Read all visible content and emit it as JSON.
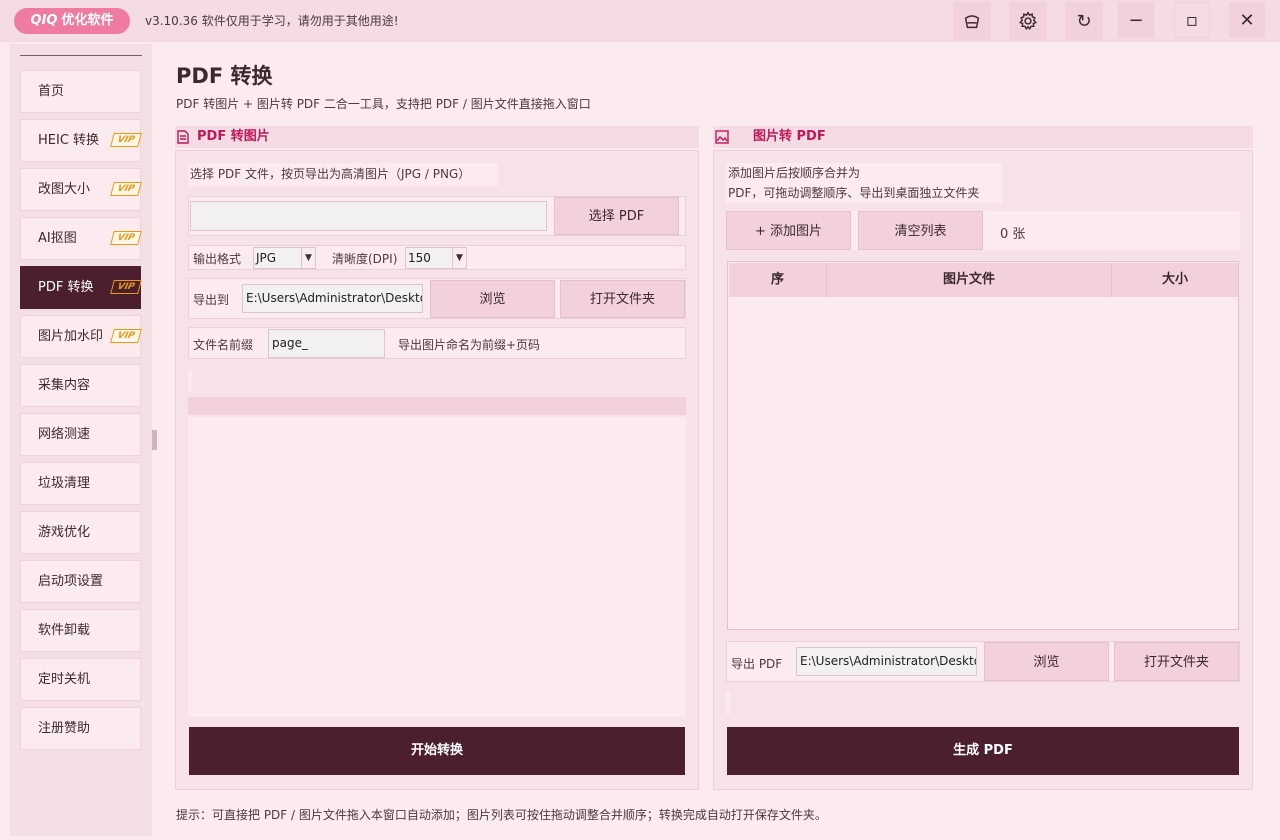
{
  "app": {
    "logo_brand": "QIQ",
    "logo_name": "优化软件",
    "version_text": "v3.10.36  软件仅用于学习，请勿用于其他用途!",
    "restore_glyph": "↻",
    "minimize_glyph": "−",
    "maximize_glyph": "▫",
    "close_glyph": "✕"
  },
  "sidebar": {
    "items": [
      {
        "label": "首页",
        "vip": false
      },
      {
        "label": "HEIC 转换",
        "vip": true
      },
      {
        "label": "改图大小",
        "vip": true
      },
      {
        "label": "AI抠图",
        "vip": true
      },
      {
        "label": "PDF 转换",
        "vip": true,
        "active": true
      },
      {
        "label": "图片加水印",
        "vip": true
      },
      {
        "label": "采集内容",
        "vip": false
      },
      {
        "label": "网络测速",
        "vip": false
      },
      {
        "label": "垃圾清理",
        "vip": false
      },
      {
        "label": "游戏优化",
        "vip": false
      },
      {
        "label": "启动项设置",
        "vip": false
      },
      {
        "label": "软件卸载",
        "vip": false
      },
      {
        "label": "定时关机",
        "vip": false
      },
      {
        "label": "注册赞助",
        "vip": false
      }
    ],
    "vip_label": "VIP"
  },
  "page": {
    "title": "PDF 转换",
    "subtitle": "PDF 转图片 + 图片转 PDF 二合一工具，支持把 PDF / 图片文件直接拖入窗口",
    "footer_tip": "提示：可直接把 PDF / 图片文件拖入本窗口自动添加；图片列表可按住拖动调整合并顺序；转换完成自动打开保存文件夹。"
  },
  "pdf_to_image": {
    "header": "PDF 转图片",
    "description": "选择 PDF 文件，按页导出为高清图片（JPG / PNG）",
    "file_value": "",
    "choose_button": "选择 PDF",
    "format_label": "输出格式",
    "format_value": "JPG",
    "dpi_label": "清晰度(DPI)",
    "dpi_value": "150",
    "export_label": "导出到",
    "export_path": "E:\\Users\\Administrator\\Desktop",
    "browse_button": "浏览",
    "open_folder_button": "打开文件夹",
    "prefix_label": "文件名前缀",
    "prefix_value": "page_",
    "prefix_hint": "导出图片命名为前缀+页码",
    "start_button": "开始转换"
  },
  "image_to_pdf": {
    "header": "图片转 PDF",
    "description_line1": "添加图片后按顺序合并为",
    "description_line2": "PDF，可拖动调整顺序、导出到桌面独立文件夹",
    "add_button": "+  添加图片",
    "clear_button": "清空列表",
    "count_text": "0 张",
    "table_headers": [
      "序",
      "图片文件",
      "大小"
    ],
    "rows": [],
    "export_label": "导出 PDF",
    "export_path": "E:\\Users\\Administrator\\Desktop",
    "browse_button": "浏览",
    "open_folder_button": "打开文件夹",
    "generate_button": "生成 PDF"
  },
  "colors": {
    "accent": "#4b1f2d",
    "header_text": "#c2185b",
    "background": "#fbeaee",
    "vip": "#e89a1a",
    "logo": "#f07ba0"
  }
}
